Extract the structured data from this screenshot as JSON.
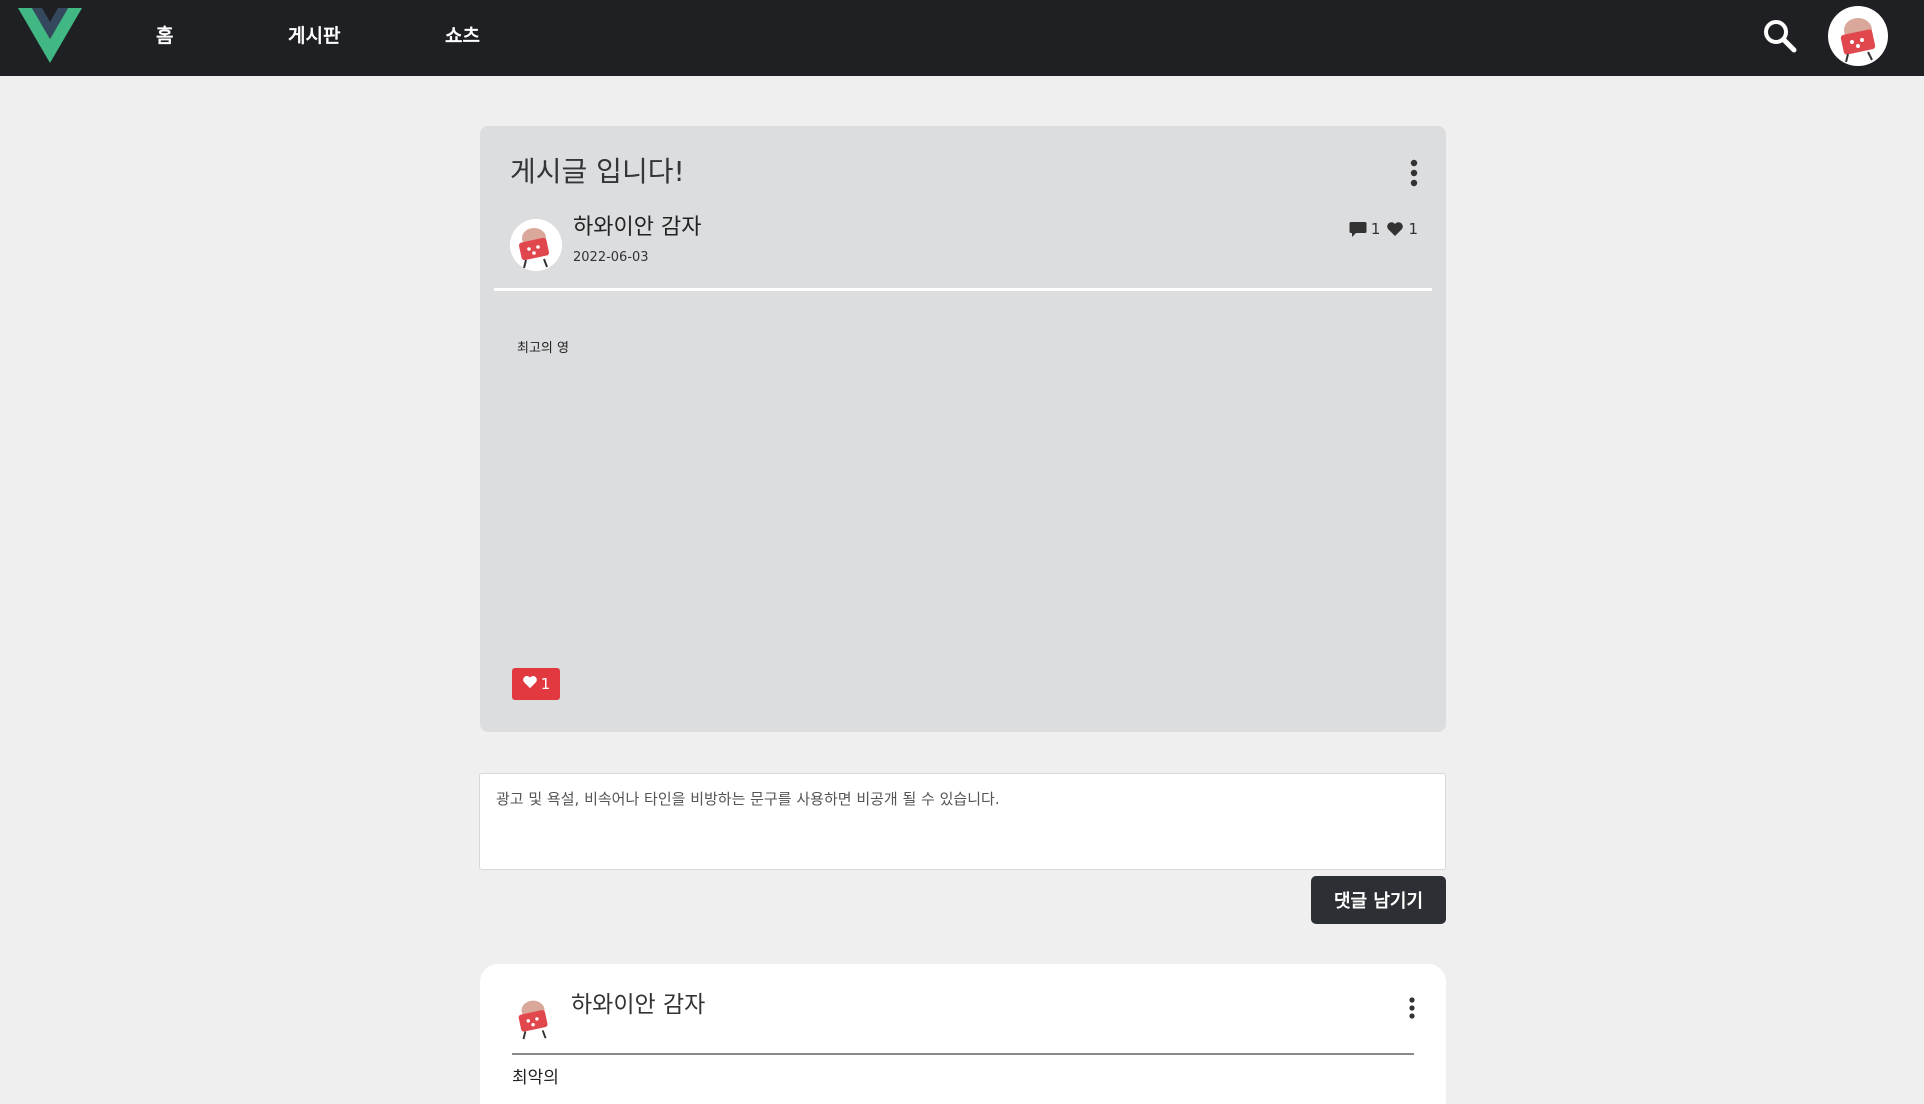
{
  "navbar": {
    "links": [
      {
        "label": "홈"
      },
      {
        "label": "게시판"
      },
      {
        "label": "쇼츠"
      }
    ]
  },
  "post": {
    "title": "게시글 입니다!",
    "author": "하와이안 감자",
    "date": "2022-06-03",
    "comment_count": "1",
    "like_count": "1",
    "body": "최고의 영",
    "like_button_count": "1"
  },
  "comment_form": {
    "placeholder": "광고 및 욕설, 비속어나 타인을 비방하는 문구를 사용하면 비공개 될 수 있습니다.",
    "submit_label": "댓글 남기기"
  },
  "comments": [
    {
      "author": "하와이안 감자",
      "text": "최악의"
    }
  ],
  "colors": {
    "navbar_bg": "#1f2023",
    "page_bg": "#efefef",
    "post_card_bg": "#dcdddf",
    "like_button_bg": "#e2383f",
    "submit_button_bg": "#2c2f33",
    "logo_outer": "#41b883",
    "logo_inner": "#35495e"
  },
  "icons": {
    "logo": "vue-logo-icon",
    "search": "search-icon",
    "more": "more-vertical-icon",
    "comment": "comment-icon",
    "heart": "heart-icon"
  }
}
